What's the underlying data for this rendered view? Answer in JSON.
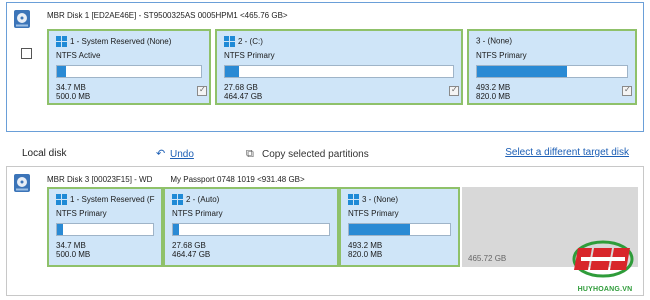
{
  "source_disk": {
    "title": "MBR Disk 1 [ED2AE46E] - ST9500325AS 0005HPM1  <465.76 GB>",
    "checked": false,
    "partitions": [
      {
        "name": "1 - System Reserved (None)",
        "type": "NTFS Active",
        "used": "34.7 MB",
        "total": "500.0 MB",
        "fill": 0.06,
        "checked": true
      },
      {
        "name": "2 -  (C:)",
        "type": "NTFS Primary",
        "used": "27.68 GB",
        "total": "464.47 GB",
        "fill": 0.06,
        "checked": true
      },
      {
        "name": "3 - (None)",
        "type": "NTFS Primary",
        "used": "493.2 MB",
        "total": "820.0 MB",
        "fill": 0.6,
        "checked": true
      }
    ]
  },
  "toolbar": {
    "local_disk_label": "Local disk",
    "undo_label": "Undo",
    "copy_label": "Copy selected partitions",
    "select_target_label": "Select a different target disk"
  },
  "target_disk": {
    "title": "MBR Disk 3 [00023F15] - WD",
    "model": "My Passport 0748 1019  <931.48 GB>",
    "partitions": [
      {
        "name": "1 - System Reserved (F",
        "type": "NTFS Primary",
        "used": "34.7 MB",
        "total": "500.0 MB",
        "fill": 0.06
      },
      {
        "name": "2 -  (Auto)",
        "type": "NTFS Primary",
        "used": "27.68 GB",
        "total": "464.47 GB",
        "fill": 0.04
      },
      {
        "name": "3 - (None)",
        "type": "NTFS Primary",
        "used": "493.2 MB",
        "total": "820.0 MB",
        "fill": 0.6
      }
    ],
    "unallocated": "465.72 GB"
  },
  "watermark": {
    "text": "HUYHOANG.VN"
  },
  "colors": {
    "accent": "#1d5fb5",
    "partition_bg": "#cfe5f8",
    "partition_border": "#8fc16a",
    "bar_fill": "#2a8ad4"
  }
}
